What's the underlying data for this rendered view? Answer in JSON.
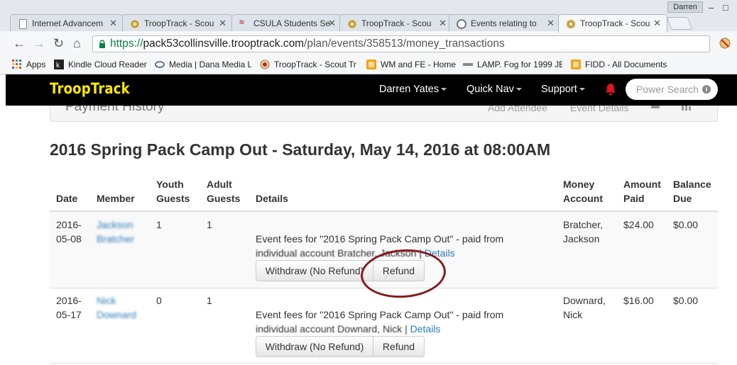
{
  "browser": {
    "tabs": [
      {
        "label": "Internet Advancem",
        "active": false
      },
      {
        "label": "TroopTrack - Scou",
        "active": false
      },
      {
        "label": "CSULA Students Se",
        "active": false
      },
      {
        "label": "TroopTrack - Scou",
        "active": false
      },
      {
        "label": "Events relating to",
        "active": false
      },
      {
        "label": "TroopTrack - Scou",
        "active": true
      }
    ],
    "profile_name": "Darren",
    "url_scheme": "https://",
    "url_host": "pack53collinsville.trooptrack.com",
    "url_path": "/plan/events/358513/money_transactions",
    "bookmarks": [
      {
        "label": "Apps",
        "icon": "apps-grid-icon"
      },
      {
        "label": "Kindle Cloud Reader",
        "icon": "kindle-icon"
      },
      {
        "label": "Media | Dana Media L",
        "icon": "media-icon"
      },
      {
        "label": "TroopTrack - Scout Tr",
        "icon": "trooptrack-icon"
      },
      {
        "label": "WM and FE - Home",
        "icon": "wm-icon"
      },
      {
        "label": "LAMP. Fog for 1999 JE",
        "icon": "lamp-icon"
      },
      {
        "label": "FIDD - All Documents",
        "icon": "fidd-icon"
      }
    ]
  },
  "site": {
    "logo": "TroopTrack",
    "nav": {
      "user": "Darren Yates",
      "quick_nav": "Quick Nav",
      "support": "Support"
    },
    "search_placeholder": "Power Search"
  },
  "payment_history": {
    "title": "Payment History",
    "add_attendee": "Add Attendee",
    "event_details": "Event Details"
  },
  "event_title": "2016 Spring Pack Camp Out - Saturday, May 14, 2016 at 08:00AM",
  "table": {
    "headers": {
      "date": "Date",
      "member": "Member",
      "youth_1": "Youth",
      "youth_2": "Guests",
      "adult_1": "Adult",
      "adult_2": "Guests",
      "details": "Details",
      "money_1": "Money",
      "money_2": "Account",
      "amount_1": "Amount",
      "amount_2": "Paid",
      "balance_1": "Balance",
      "balance_2": "Due"
    },
    "rows": [
      {
        "date_1": "2016-",
        "date_2": "05-08",
        "member_1": "Jackson",
        "member_2": "Bratcher",
        "youth": "1",
        "adult": "1",
        "details_1": "Event fees for \"2016 Spring Pack Camp Out\" - paid from",
        "details_2": "individual account Bratcher, Jackson | ",
        "details_link": "Details",
        "account_1": "Bratcher,",
        "account_2": "Jackson",
        "amount": "$24.00",
        "balance": "$0.00",
        "withdraw_label": "Withdraw (No Refund)",
        "refund_label": "Refund"
      },
      {
        "date_1": "2016-",
        "date_2": "05-17",
        "member_1": "Nick",
        "member_2": "Downard",
        "youth": "0",
        "adult": "1",
        "details_1": "Event fees for \"2016 Spring Pack Camp Out\" - paid from",
        "details_2": "individual account Downard, Nick | ",
        "details_link": "Details",
        "account_1": "Downard,",
        "account_2": "Nick",
        "amount": "$16.00",
        "balance": "$0.00",
        "withdraw_label": "Withdraw (No Refund)",
        "refund_label": "Refund"
      }
    ]
  }
}
